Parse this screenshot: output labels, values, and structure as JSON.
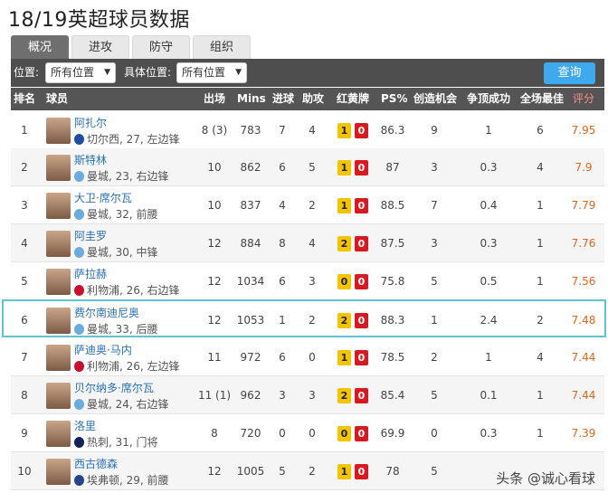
{
  "page": {
    "title": "18/19英超球员数据"
  },
  "tabs": [
    {
      "label": "概况",
      "active": true
    },
    {
      "label": "进攻",
      "active": false
    },
    {
      "label": "防守",
      "active": false
    },
    {
      "label": "组织",
      "active": false
    }
  ],
  "filters": {
    "position_label": "位置:",
    "position_value": "所有位置",
    "detail_label": "具体位置:",
    "detail_value": "所有位置",
    "query_label": "查询"
  },
  "headers": {
    "rank": "排名",
    "player": "球员",
    "apps": "出场",
    "mins": "Mins",
    "goals": "进球",
    "assists": "助攻",
    "cards": "红黄牌",
    "ps": "PS%",
    "chances": "创造机会",
    "aerials": "争顶成功",
    "motm": "全场最佳",
    "rating": "评分"
  },
  "colors": {
    "crest_chelsea": "#1d4ea0",
    "crest_mancity": "#6cabdd",
    "crest_liverpool": "#c8102e",
    "crest_spurs": "#132257",
    "crest_everton": "#274488"
  },
  "rows": [
    {
      "rank": "1",
      "name": "阿扎尔",
      "info": "切尔西, 27, 左边锋",
      "crest": "#1d4ea0",
      "apps": "8 (3)",
      "mins": "783",
      "goals": "7",
      "assists": "4",
      "yellow": "1",
      "red": "0",
      "ps": "86.3",
      "chances": "9",
      "aerials": "1",
      "motm": "6",
      "rating": "7.95"
    },
    {
      "rank": "2",
      "name": "斯特林",
      "info": "曼城, 23, 右边锋",
      "crest": "#6cabdd",
      "apps": "10",
      "mins": "862",
      "goals": "6",
      "assists": "5",
      "yellow": "1",
      "red": "0",
      "ps": "87",
      "chances": "3",
      "aerials": "0.3",
      "motm": "4",
      "rating": "7.9"
    },
    {
      "rank": "3",
      "name": "大卫·席尔瓦",
      "info": "曼城, 32, 前腰",
      "crest": "#6cabdd",
      "apps": "10",
      "mins": "837",
      "goals": "4",
      "assists": "2",
      "yellow": "1",
      "red": "0",
      "ps": "88.5",
      "chances": "7",
      "aerials": "0.4",
      "motm": "1",
      "rating": "7.79"
    },
    {
      "rank": "4",
      "name": "阿圭罗",
      "info": "曼城, 30, 中锋",
      "crest": "#6cabdd",
      "apps": "12",
      "mins": "884",
      "goals": "8",
      "assists": "4",
      "yellow": "2",
      "red": "0",
      "ps": "87.5",
      "chances": "3",
      "aerials": "0.3",
      "motm": "1",
      "rating": "7.76"
    },
    {
      "rank": "5",
      "name": "萨拉赫",
      "info": "利物浦, 26, 右边锋",
      "crest": "#c8102e",
      "apps": "12",
      "mins": "1034",
      "goals": "6",
      "assists": "3",
      "yellow": "0",
      "red": "0",
      "ps": "75.8",
      "chances": "5",
      "aerials": "0.5",
      "motm": "1",
      "rating": "7.56"
    },
    {
      "rank": "6",
      "name": "费尔南迪尼奥",
      "info": "曼城, 33, 后腰",
      "crest": "#6cabdd",
      "apps": "12",
      "mins": "1053",
      "goals": "1",
      "assists": "2",
      "yellow": "2",
      "red": "0",
      "ps": "88.3",
      "chances": "1",
      "aerials": "2.4",
      "motm": "2",
      "rating": "7.48"
    },
    {
      "rank": "7",
      "name": "萨迪奥·马内",
      "info": "利物浦, 26, 左边锋",
      "crest": "#c8102e",
      "apps": "11",
      "mins": "972",
      "goals": "6",
      "assists": "0",
      "yellow": "1",
      "red": "0",
      "ps": "78.5",
      "chances": "2",
      "aerials": "1",
      "motm": "4",
      "rating": "7.44"
    },
    {
      "rank": "8",
      "name": "贝尔纳多·席尔瓦",
      "info": "曼城, 24, 右边锋",
      "crest": "#6cabdd",
      "apps": "11 (1)",
      "mins": "962",
      "goals": "3",
      "assists": "3",
      "yellow": "2",
      "red": "0",
      "ps": "85.4",
      "chances": "5",
      "aerials": "0.1",
      "motm": "1",
      "rating": "7.44"
    },
    {
      "rank": "9",
      "name": "洛里",
      "info": "热刺, 31, 门将",
      "crest": "#132257",
      "apps": "8",
      "mins": "720",
      "goals": "0",
      "assists": "0",
      "yellow": "0",
      "red": "0",
      "ps": "69.9",
      "chances": "0",
      "aerials": "0.3",
      "motm": "1",
      "rating": "7.39"
    },
    {
      "rank": "10",
      "name": "西古德森",
      "info": "埃弗顿, 29, 前腰",
      "crest": "#274488",
      "apps": "12",
      "mins": "1005",
      "goals": "5",
      "assists": "2",
      "yellow": "1",
      "red": "0",
      "ps": "78",
      "chances": "5",
      "aerials": "",
      "motm": "",
      "rating": ""
    }
  ],
  "watermark": "头条 @诚心看球"
}
